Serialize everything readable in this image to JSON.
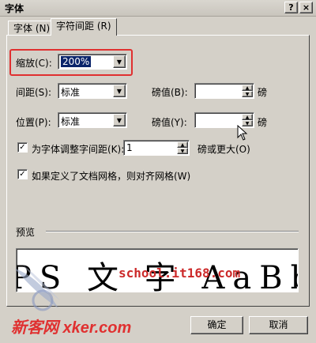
{
  "window": {
    "title": "字体",
    "help_label": "?",
    "close_label": "×"
  },
  "tabs": [
    {
      "label": "字体 (N)",
      "active": false
    },
    {
      "label": "字符间距 (R)",
      "active": true
    }
  ],
  "scale": {
    "label": "缩放(C):",
    "value": "200%"
  },
  "spacing": {
    "label": "间距(S):",
    "value": "标准",
    "amount_label": "磅值(B):",
    "amount_value": "",
    "unit": "磅"
  },
  "position": {
    "label": "位置(P):",
    "value": "标准",
    "amount_label": "磅值(Y):",
    "amount_value": "",
    "unit": "磅"
  },
  "kerning": {
    "checked": true,
    "label": "为字体调整字间距(K):",
    "value": "1",
    "suffix": "磅或更大(O)"
  },
  "grid": {
    "checked": true,
    "label": "如果定义了文档网格，则对齐网格(W)"
  },
  "preview": {
    "label": "预览",
    "text": "PS 文 字 AaBb"
  },
  "buttons": {
    "ok": "确定",
    "cancel": "取消"
  },
  "watermark": {
    "site": "school.it168.com",
    "logo": "新客网 xker.com"
  },
  "colors": {
    "highlight": "#e03030",
    "selection": "#0a246a",
    "dialog": "#d4d0c8"
  }
}
